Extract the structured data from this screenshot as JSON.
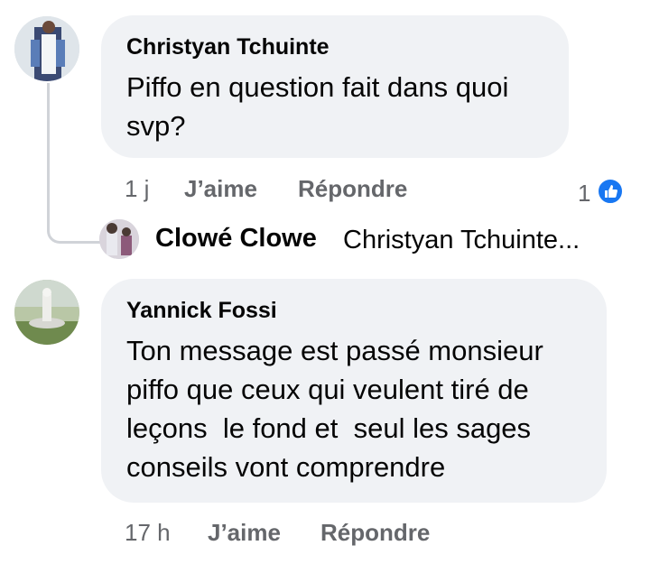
{
  "comments": [
    {
      "author": "Christyan Tchuinte",
      "text_lines": [
        "Piffo en question fait dans quoi",
        "svp?"
      ],
      "time": "1 j",
      "like_label": "J’aime",
      "reply_label": "Répondre",
      "reaction_count": "1",
      "reaction_icon": "like-icon",
      "reaction_color": "#1877f2"
    },
    {
      "author": "Yannick Fossi",
      "text_lines": [
        "Ton message est passé monsieur",
        "piffo que ceux qui veulent tiré de",
        "leçons  le fond et  seul les sages",
        "conseils vont comprendre"
      ],
      "time": "17 h",
      "like_label": "J’aime",
      "reply_label": "Répondre"
    }
  ],
  "reply_preview": {
    "author": "Clowé Clowe",
    "text": "Christyan Tchuinte..."
  }
}
